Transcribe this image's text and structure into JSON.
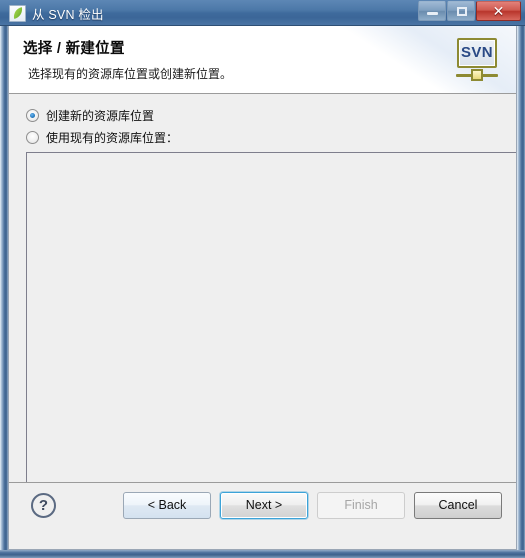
{
  "window": {
    "title": "从 SVN 检出",
    "app_icon": "svn-leaf-icon",
    "controls": {
      "minimize_label": "",
      "maximize_label": "",
      "close_label": "✕"
    }
  },
  "header": {
    "title": "选择 / 新建位置",
    "subtitle": "选择现有的资源库位置或创建新位置。",
    "logo_text": "SVN"
  },
  "main": {
    "options": [
      {
        "label": "创建新的资源库位置",
        "selected": true
      },
      {
        "label": "使用现有的资源库位置：",
        "selected": false
      }
    ],
    "repository_list": {
      "items": [],
      "enabled": false
    }
  },
  "footer": {
    "help_label": "?",
    "buttons": [
      {
        "label": "< Back",
        "state": "normal"
      },
      {
        "label": "Next >",
        "state": "default"
      },
      {
        "label": "Finish",
        "state": "disabled"
      },
      {
        "label": "Cancel",
        "state": "plain"
      }
    ]
  },
  "colors": {
    "titlebar": "#3f6b9d",
    "accent_focus": "#3ca3d8",
    "close_button": "#b8352c",
    "svn_text": "#2b4a86",
    "svn_border": "#8d8a33",
    "body_bg": "#efefef"
  }
}
